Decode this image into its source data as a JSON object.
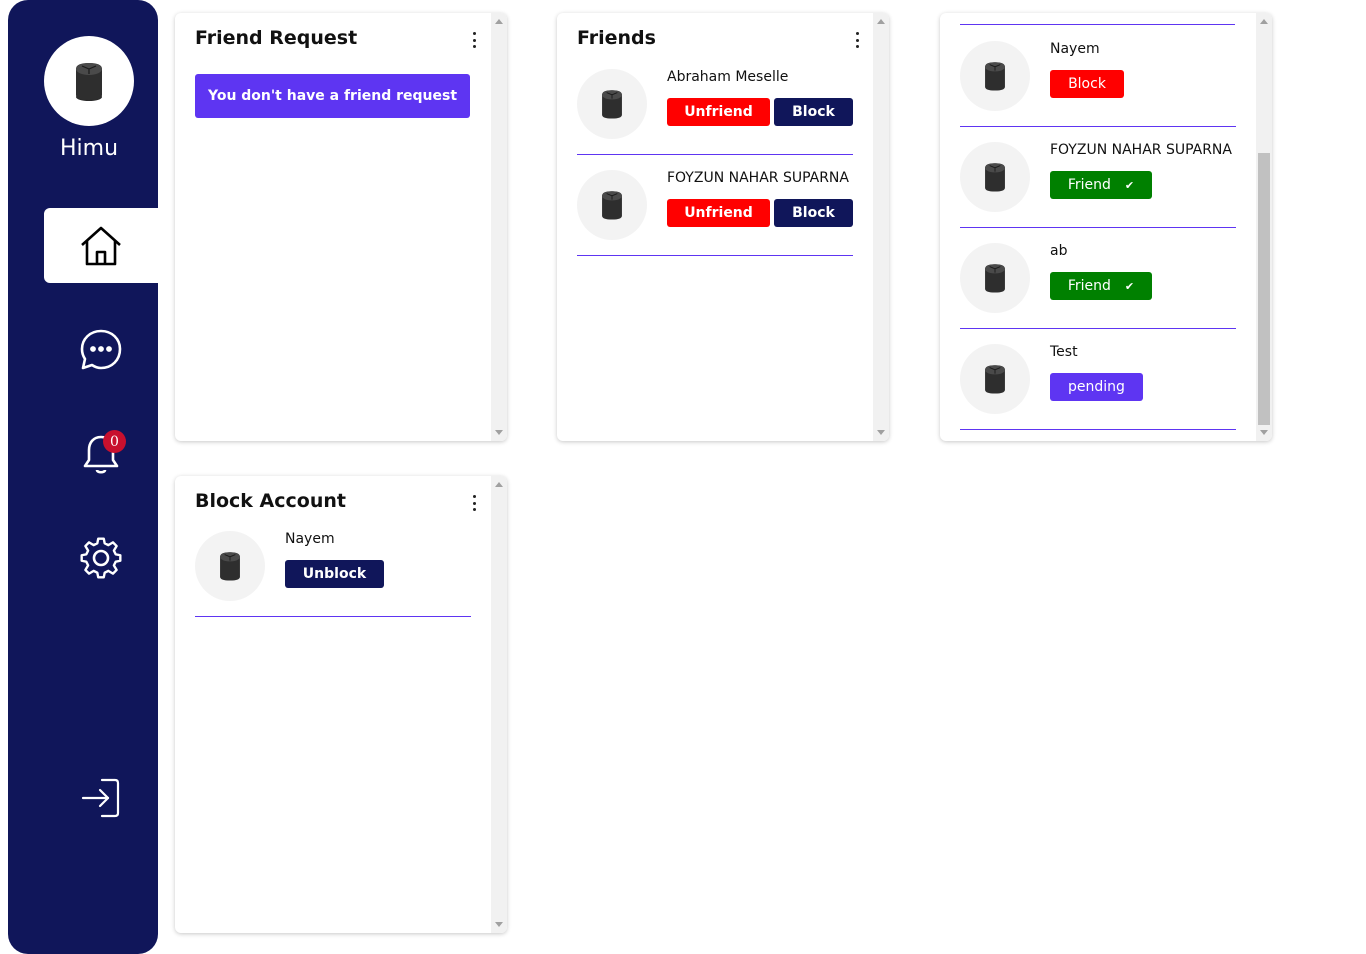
{
  "user": {
    "name": "Himu"
  },
  "notifications": {
    "count": "0"
  },
  "friend_request_card": {
    "title": "Friend Request",
    "empty_message": "You don't have a friend request"
  },
  "friends_card": {
    "title": "Friends",
    "friends": [
      {
        "name": "Abraham Meselle",
        "unfriend_label": "Unfriend",
        "block_label": "Block"
      },
      {
        "name": "FOYZUN NAHAR SUPARNA",
        "unfriend_label": "Unfriend",
        "block_label": "Block"
      }
    ]
  },
  "users_card": {
    "users": [
      {
        "name": "Nayem",
        "action_label": "Block",
        "action_type": "block"
      },
      {
        "name": "FOYZUN NAHAR SUPARNA",
        "action_label": "Friend",
        "action_type": "friend"
      },
      {
        "name": "ab",
        "action_label": "Friend",
        "action_type": "friend"
      },
      {
        "name": "Test",
        "action_label": "pending",
        "action_type": "pending"
      }
    ]
  },
  "block_card": {
    "title": "Block Account",
    "blocked": [
      {
        "name": "Nayem",
        "unblock_label": "Unblock"
      }
    ]
  },
  "icons": {
    "home": "home-icon",
    "messages": "chat-icon",
    "notifications": "bell-icon",
    "settings": "gear-icon",
    "logout": "logout-icon",
    "menu": "kebab-menu-icon",
    "friend_check": "✔"
  },
  "colors": {
    "sidebar": "#10165a",
    "accent": "#5e35f2",
    "danger": "#ff0000",
    "success": "#008000",
    "badge": "#c8102e"
  }
}
